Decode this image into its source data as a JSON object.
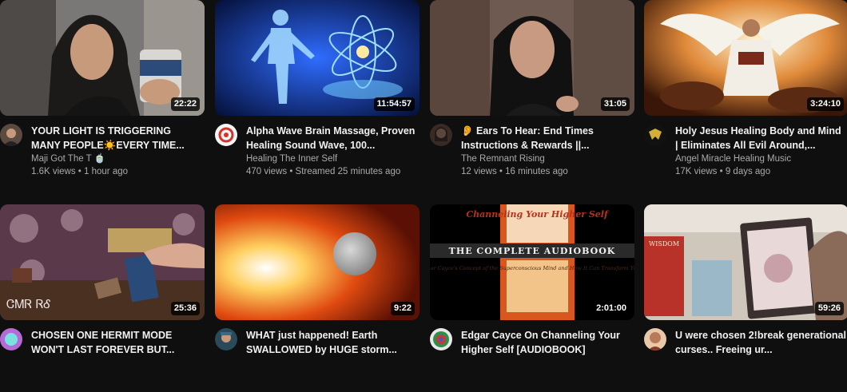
{
  "videos": [
    {
      "title": "YOUR LIGHT IS TRIGGERING MANY PEOPLE☀️EVERY TIME...",
      "channel": "Maji Got The T 🍵",
      "stats": "1.6K views • 1 hour ago",
      "duration": "22:22"
    },
    {
      "title": "Alpha Wave Brain Massage, Proven Healing Sound Wave, 100...",
      "channel": "Healing The Inner Self",
      "stats": "470 views • Streamed 25 minutes ago",
      "duration": "11:54:57"
    },
    {
      "title": "👂 Ears To Hear: End Times Instructions & Rewards ||...",
      "channel": "The Remnant Rising",
      "stats": "12 views • 16 minutes ago",
      "duration": "31:05"
    },
    {
      "title": "Holy Jesus Healing Body and Mind | Eliminates All Evil Around,...",
      "channel": "Angel Miracle Healing Music",
      "stats": "17K views • 9 days ago",
      "duration": "3:24:10"
    },
    {
      "title": "CHOSEN ONE HERMIT MODE WON'T LAST FOREVER BUT...",
      "channel": "",
      "stats": "",
      "duration": "25:36",
      "thumb_text": "ᏣᎷᏒ ᏒᎴ"
    },
    {
      "title": "WHAT just happened! Earth SWALLOWED by HUGE storm...",
      "channel": "",
      "stats": "",
      "duration": "9:22"
    },
    {
      "title": "Edgar Cayce On Channeling Your Higher Self [AUDIOBOOK]",
      "channel": "",
      "stats": "",
      "duration": "2:01:00",
      "thumb_text": {
        "heading": "Channeling Your Higher Self",
        "banner": "THE COMPLETE AUDIOBOOK",
        "sub": "Edgar Cayce's Concept of the Superconscious Mind and How It Can Transform Your Life"
      }
    },
    {
      "title": "U were chosen 2!break generational curses.. Freeing ur...",
      "channel": "",
      "stats": "",
      "duration": "59:26",
      "thumb_text": "WISDOM"
    }
  ]
}
